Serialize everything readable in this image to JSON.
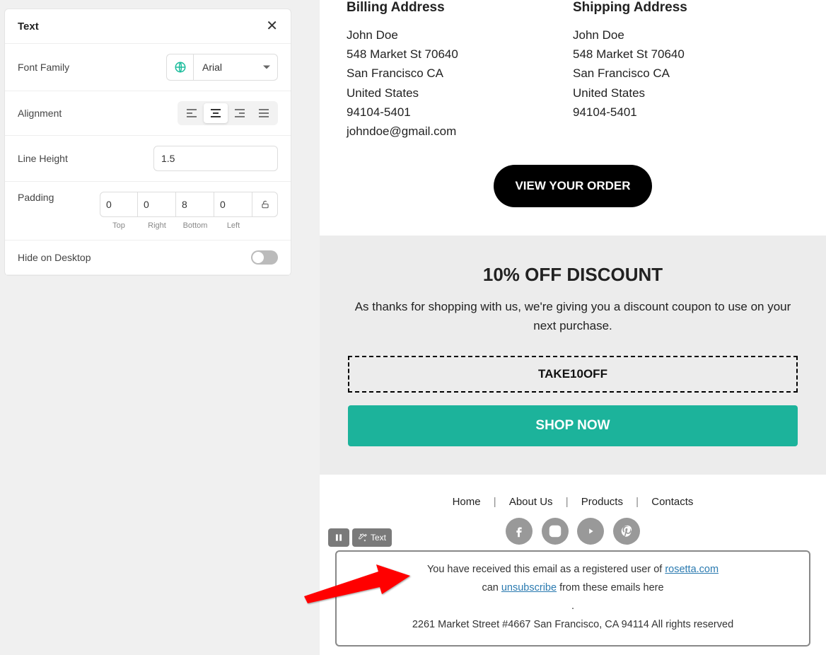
{
  "panel": {
    "title": "Text",
    "fontFamily": {
      "label": "Font Family",
      "value": "Arial"
    },
    "alignment": {
      "label": "Alignment"
    },
    "lineHeight": {
      "label": "Line Height",
      "value": "1.5"
    },
    "padding": {
      "label": "Padding",
      "top": "0",
      "right": "0",
      "bottom": "8",
      "left": "0",
      "topLabel": "Top",
      "rightLabel": "Right",
      "bottomLabel": "Bottom",
      "leftLabel": "Left"
    },
    "hideDesktop": {
      "label": "Hide on Desktop",
      "value": false
    }
  },
  "preview": {
    "billing": {
      "heading": "Billing Address",
      "name": "John Doe",
      "street": "548 Market St 70640",
      "city": "San Francisco CA",
      "country": "United States",
      "zip": "94104-5401",
      "email": "johndoe@gmail.com"
    },
    "shipping": {
      "heading": "Shipping Address",
      "name": "John Doe",
      "street": "548 Market St 70640",
      "city": "San Francisco CA",
      "country": "United States",
      "zip": "94104-5401"
    },
    "viewOrder": "VIEW YOUR ORDER",
    "discount": {
      "heading": "10% OFF DISCOUNT",
      "text": "As thanks for shopping with us, we're giving you a discount coupon to use on your next purchase.",
      "code": "TAKE10OFF",
      "cta": "SHOP NOW"
    },
    "footerLinks": [
      "Home",
      "About Us",
      "Products",
      "Contacts"
    ],
    "unsub": {
      "line1a": "You have received this email as a registered user of ",
      "line1link": "rosetta.com",
      "line2a": "can ",
      "line2link": "unsubscribe",
      "line2b": " from these emails here",
      "dot": ".",
      "addr": "2261 Market Street #4667 San Francisco, CA 94114 All rights reserved"
    }
  },
  "tags": {
    "textLabel": "Text"
  }
}
